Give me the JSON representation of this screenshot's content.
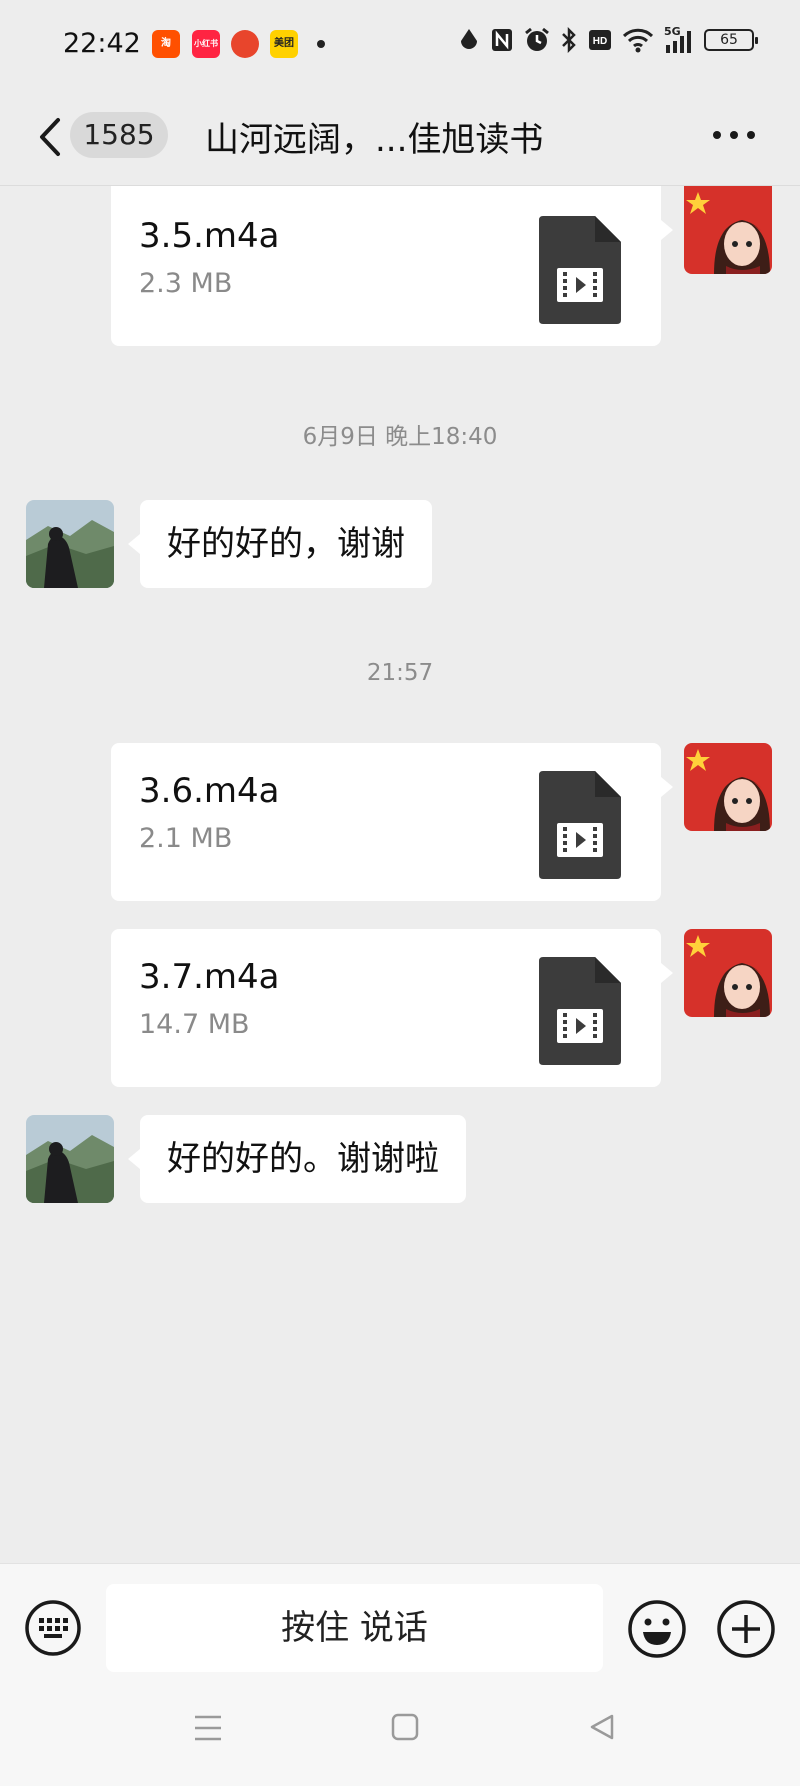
{
  "status_bar": {
    "time": "22:42",
    "notifications": [
      {
        "name": "taobao-notification-icon",
        "label": "淘",
        "color": "#ff5000"
      },
      {
        "name": "xiaohongshu-notification-icon",
        "label": "小红书",
        "color": "#ff2442"
      },
      {
        "name": "app-notification-icon",
        "label": "",
        "color": "#e8452c"
      },
      {
        "name": "meituan-notification-icon",
        "label": "美团",
        "color": "#ffd100"
      }
    ],
    "network": "5G",
    "battery": "65"
  },
  "nav": {
    "unread_count": "1585",
    "title": "山河远阔，...佳旭读书"
  },
  "messages": [
    {
      "type": "file",
      "side": "right",
      "file_name": "3.5.m4a",
      "file_size": "2.3 MB"
    },
    {
      "type": "timestamp",
      "text": "6月9日 晚上18:40"
    },
    {
      "type": "text",
      "side": "left",
      "text": "好的好的，谢谢"
    },
    {
      "type": "timestamp",
      "text": "21:57"
    },
    {
      "type": "file",
      "side": "right",
      "file_name": "3.6.m4a",
      "file_size": "2.1 MB"
    },
    {
      "type": "file",
      "side": "right",
      "file_name": "3.7.m4a",
      "file_size": "14.7 MB"
    },
    {
      "type": "text",
      "side": "left",
      "text": "好的好的。谢谢啦"
    }
  ],
  "input_bar": {
    "voice_label": "按住 说话"
  },
  "colors": {
    "background": "#ededed",
    "bubble": "#ffffff",
    "file_icon": "#3c3c3c",
    "timestamp": "#8c8c8c"
  }
}
